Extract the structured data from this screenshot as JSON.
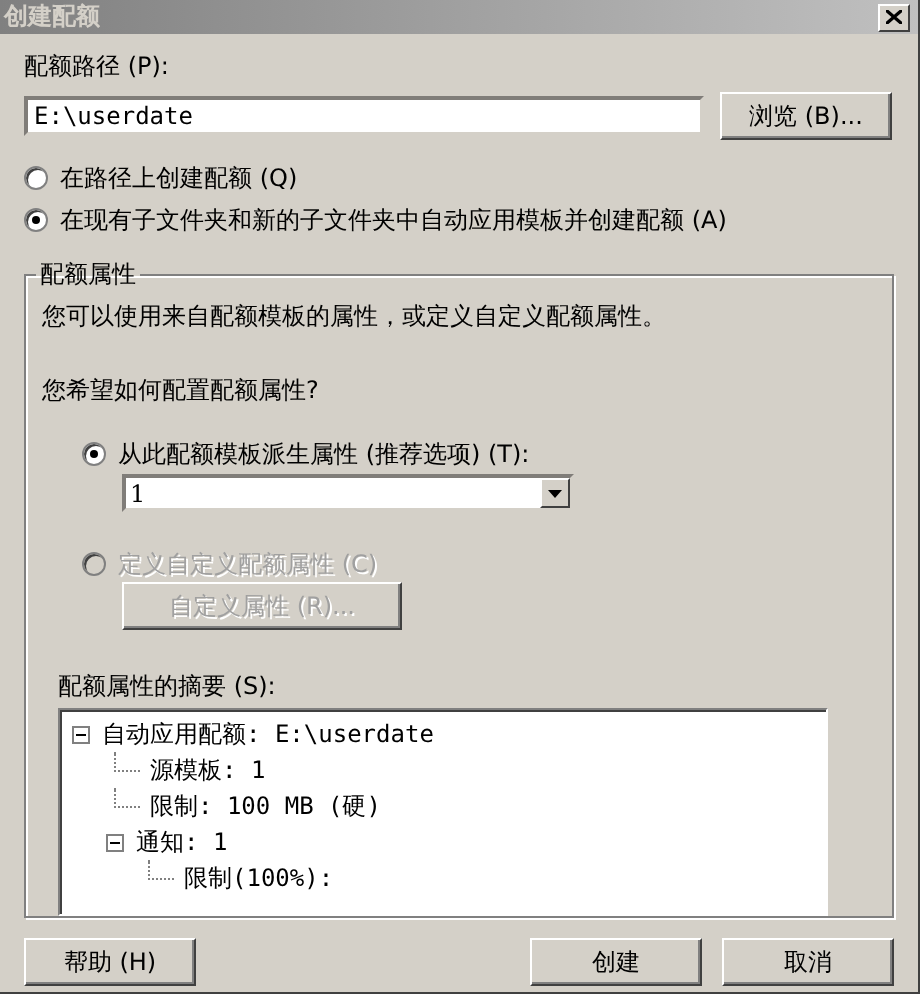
{
  "window": {
    "title": "创建配额"
  },
  "path": {
    "label": "配额路径 (P):",
    "value": "E:\\userdate"
  },
  "browse_button": {
    "label": "浏览 (B)..."
  },
  "mode_options": [
    {
      "label": "在路径上创建配额 (Q)",
      "selected": false
    },
    {
      "label": "在现有子文件夹和新的子文件夹中自动应用模板并创建配额 (A)",
      "selected": true
    }
  ],
  "group": {
    "title": "配额属性",
    "description": "您可以使用来自配额模板的属性，或定义自定义配额属性。",
    "question": "您希望如何配置配额属性?",
    "source_options": [
      {
        "label": "从此配额模板派生属性 (推荐选项) (T):",
        "selected": true,
        "disabled": false
      },
      {
        "label": "定义自定义配额属性 (C)",
        "selected": false,
        "disabled": true
      }
    ],
    "template_select": {
      "value": "1"
    },
    "custom_button": {
      "label": "自定义属性 (R)...",
      "disabled": true
    },
    "summary_label": "配额属性的摘要 (S):",
    "summary_tree": [
      {
        "label": "自动应用配额: E:\\userdate",
        "expanded": true,
        "children": [
          {
            "label": "源模板: 1"
          },
          {
            "label": "限制: 100 MB (硬)"
          },
          {
            "label": "通知: 1",
            "expanded": true,
            "children": [
              {
                "label": "限制(100%):"
              }
            ]
          }
        ]
      }
    ]
  },
  "buttons": [
    {
      "label": "帮助 (H)"
    },
    {
      "label": "创建"
    },
    {
      "label": "取消"
    }
  ]
}
